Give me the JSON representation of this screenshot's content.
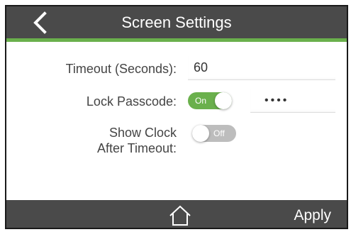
{
  "header": {
    "title": "Screen Settings",
    "back_icon": "chevron-left-icon"
  },
  "settings": {
    "timeout": {
      "label": "Timeout (Seconds):",
      "value": "60"
    },
    "lock_passcode": {
      "label": "Lock Passcode:",
      "toggle_state": "On",
      "passcode_value": "••••"
    },
    "show_clock": {
      "label_line1": "Show Clock",
      "label_line2": "After Timeout:",
      "toggle_state": "Off"
    }
  },
  "footer": {
    "home_icon": "home-icon",
    "apply_label": "Apply"
  },
  "colors": {
    "header_bg": "#4a4a4a",
    "accent": "#6ab04c",
    "toggle_off": "#bdbdbd"
  }
}
